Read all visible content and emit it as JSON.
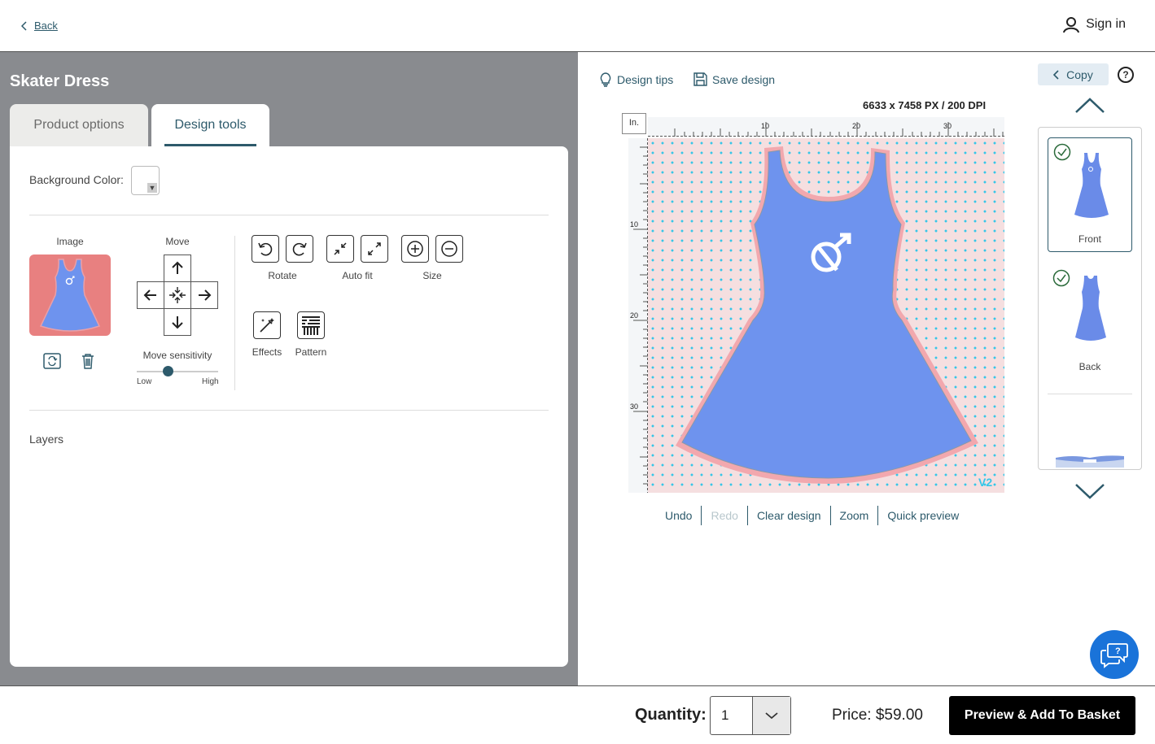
{
  "header": {
    "back_label": "Back",
    "signin_label": "Sign in"
  },
  "product": {
    "title": "Skater Dress"
  },
  "tabs": [
    {
      "label": "Product options"
    },
    {
      "label": "Design tools"
    }
  ],
  "design_tools": {
    "background_label": "Background Color:",
    "image_label": "Image",
    "move_label": "Move",
    "rotate_label": "Rotate",
    "autofit_label": "Auto fit",
    "size_label": "Size",
    "effects_label": "Effects",
    "pattern_label": "Pattern",
    "sensitivity_label": "Move sensitivity",
    "low_label": "Low",
    "high_label": "High",
    "sensitivity_value": 0.38,
    "layers_label": "Layers"
  },
  "canvas": {
    "design_tips": "Design tips",
    "save_design": "Save design",
    "dimensions": "6633 x 7458 PX / 200 DPI",
    "unit": "In.",
    "ruler_top_ticks": [
      "10",
      "20",
      "30"
    ],
    "ruler_left_ticks": [
      "10",
      "20",
      "30"
    ],
    "watermark": "V2",
    "actions": [
      "Undo",
      "Redo",
      "Clear design",
      "Zoom",
      "Quick preview"
    ]
  },
  "views": {
    "copy_label": "Copy",
    "help_label": "?",
    "items": [
      {
        "label": "Front"
      },
      {
        "label": "Back"
      }
    ]
  },
  "footer": {
    "quantity_label": "Quantity:",
    "quantity_value": "1",
    "price": "Price: $59.00",
    "buy_label": "Preview & Add To Basket"
  },
  "colors": {
    "accent": "#2d5a6b",
    "dress_blue": "#6e93ee",
    "dress_trim": "#f0a0a8",
    "canvas_bg": "#f5dfe0",
    "dot": "#35c6e8",
    "chat_blue": "#1a73d9"
  }
}
